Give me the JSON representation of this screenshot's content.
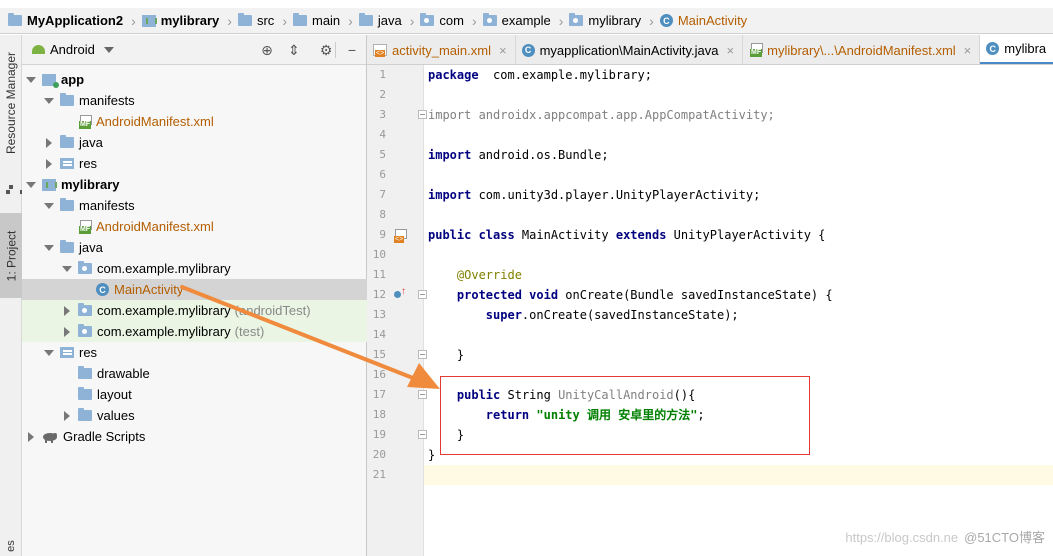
{
  "breadcrumb": [
    {
      "label": "MyApplication2",
      "icon": "folder-icon",
      "bold": true
    },
    {
      "label": "mylibrary",
      "icon": "library-module-icon",
      "bold": true
    },
    {
      "label": "src",
      "icon": "folder-icon"
    },
    {
      "label": "main",
      "icon": "folder-icon"
    },
    {
      "label": "java",
      "icon": "folder-icon"
    },
    {
      "label": "com",
      "icon": "package-icon"
    },
    {
      "label": "example",
      "icon": "package-icon"
    },
    {
      "label": "mylibrary",
      "icon": "package-icon"
    },
    {
      "label": "MainActivity",
      "icon": "class-icon",
      "active": true
    }
  ],
  "left_strip": {
    "resource_manager": "Resource Manager",
    "project": "1: Project",
    "bottom": "es"
  },
  "project_panel": {
    "view_mode": "Android",
    "class_icon_letter": "C",
    "tree": [
      {
        "label": "app",
        "level": 0,
        "arrow": "down",
        "icon": "module",
        "bold": true
      },
      {
        "label": "manifests",
        "level": 1,
        "arrow": "down",
        "icon": "folder"
      },
      {
        "label": "AndroidManifest.xml",
        "level": 2,
        "arrow": "none",
        "icon": "manifest",
        "orange": true
      },
      {
        "label": "java",
        "level": 1,
        "arrow": "right",
        "icon": "folder"
      },
      {
        "label": "res",
        "level": 1,
        "arrow": "right",
        "icon": "res"
      },
      {
        "label": "mylibrary",
        "level": 0,
        "arrow": "down",
        "icon": "library",
        "bold": true
      },
      {
        "label": "manifests",
        "level": 1,
        "arrow": "down",
        "icon": "folder"
      },
      {
        "label": "AndroidManifest.xml",
        "level": 2,
        "arrow": "none",
        "icon": "manifest",
        "orange": true
      },
      {
        "label": "java",
        "level": 1,
        "arrow": "down",
        "icon": "folder"
      },
      {
        "label": "com.example.mylibrary",
        "level": 2,
        "arrow": "down",
        "icon": "package"
      },
      {
        "label": "MainActivity",
        "level": 3,
        "arrow": "none",
        "icon": "class",
        "orange": true,
        "selected": true
      },
      {
        "label": "com.example.mylibrary",
        "suffix": "(androidTest)",
        "level": 2,
        "arrow": "right",
        "icon": "package",
        "test": true
      },
      {
        "label": "com.example.mylibrary",
        "suffix": "(test)",
        "level": 2,
        "arrow": "right",
        "icon": "package",
        "test": true
      },
      {
        "label": "res",
        "level": 1,
        "arrow": "down",
        "icon": "res"
      },
      {
        "label": "drawable",
        "level": 2,
        "arrow": "none",
        "icon": "folder"
      },
      {
        "label": "layout",
        "level": 2,
        "arrow": "none",
        "icon": "folder"
      },
      {
        "label": "values",
        "level": 2,
        "arrow": "right",
        "icon": "folder"
      },
      {
        "label": "Gradle Scripts",
        "level": 0,
        "arrow": "right",
        "icon": "gradle"
      }
    ]
  },
  "editor_tabs": [
    {
      "label": "activity_main.xml",
      "icon": "xml-file-icon"
    },
    {
      "label": "myapplication\\MainActivity.java",
      "icon": "class-icon",
      "blue": true
    },
    {
      "label": "mylibrary\\...\\AndroidManifest.xml",
      "icon": "manifest-icon"
    },
    {
      "label": "mylibra",
      "icon": "class-icon",
      "blue": true,
      "active": true
    }
  ],
  "code_lines": [
    [
      [
        "kw",
        "package"
      ],
      [
        "",
        "  com.example.mylibrary;"
      ]
    ],
    [],
    [
      [
        "gray",
        "import androidx.appcompat.app.AppCompatActivity;"
      ]
    ],
    [],
    [
      [
        "kw",
        "import"
      ],
      [
        "",
        " android.os.Bundle;"
      ]
    ],
    [],
    [
      [
        "kw",
        "import"
      ],
      [
        "",
        " com.unity3d.player.UnityPlayerActivity;"
      ]
    ],
    [],
    [
      [
        "kw",
        "public class"
      ],
      [
        "",
        " MainActivity "
      ],
      [
        "kw",
        "extends"
      ],
      [
        "",
        " UnityPlayerActivity {"
      ]
    ],
    [],
    [
      [
        "",
        "    "
      ],
      [
        "annot",
        "@Override"
      ]
    ],
    [
      [
        "",
        "    "
      ],
      [
        "kw",
        "protected void"
      ],
      [
        "",
        " onCreate(Bundle savedInstanceState) {"
      ]
    ],
    [
      [
        "",
        "        "
      ],
      [
        "kw",
        "super"
      ],
      [
        "",
        ".onCreate(savedInstanceState);"
      ]
    ],
    [],
    [
      [
        "",
        "    }"
      ]
    ],
    [],
    [
      [
        "",
        "    "
      ],
      [
        "kw",
        "public"
      ],
      [
        "",
        " String "
      ],
      [
        "gray",
        "UnityCallAndroid"
      ],
      [
        "",
        "(){"
      ]
    ],
    [
      [
        "",
        "        "
      ],
      [
        "kw",
        "return"
      ],
      [
        "",
        " "
      ],
      [
        "str",
        "\"unity 调用 安卓里的方法\""
      ],
      [
        "",
        ";"
      ]
    ],
    [
      [
        "",
        "    }"
      ]
    ],
    [
      [
        "",
        "}"
      ]
    ],
    []
  ],
  "line_numbers": [
    "1",
    "2",
    "3",
    "4",
    "5",
    "6",
    "7",
    "8",
    "9",
    "10",
    "11",
    "12",
    "13",
    "14",
    "15",
    "16",
    "17",
    "18",
    "19",
    "20",
    "21"
  ],
  "watermark": {
    "url": "https://blog.csdn.ne",
    "brand": "@51CTO博客"
  },
  "colors": {
    "accent": "#4a88c7",
    "highlight_box": "#e53935",
    "arrow": "#f08a3c",
    "file_orange": "#b45e00"
  }
}
